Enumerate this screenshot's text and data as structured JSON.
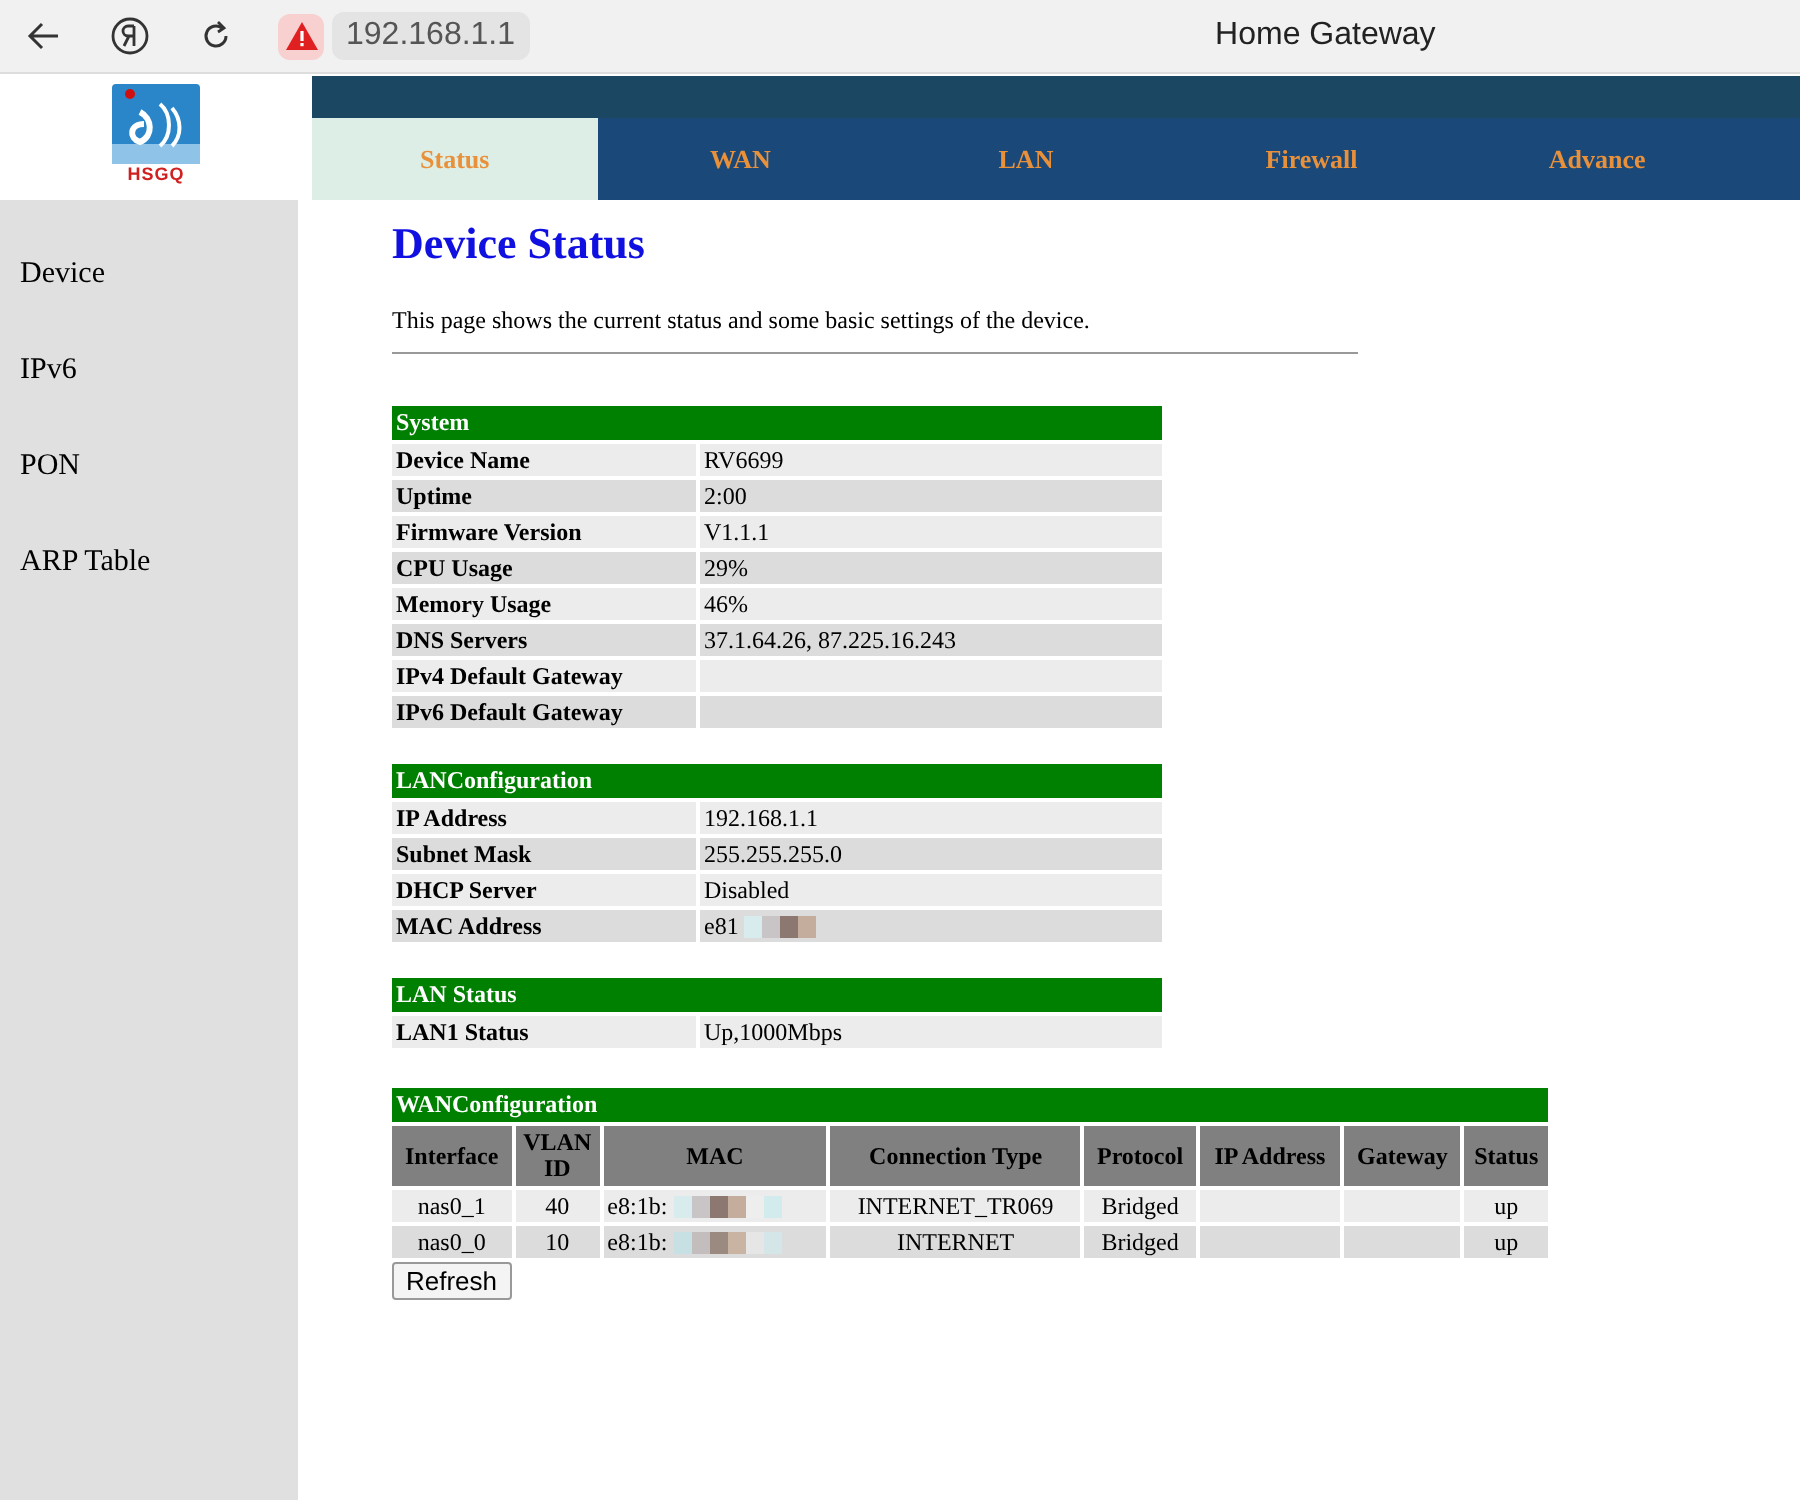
{
  "browser": {
    "address": "192.168.1.1",
    "title": "Home Gateway"
  },
  "logo": {
    "text": "HSGQ"
  },
  "tabs": [
    {
      "label": "Status",
      "selected": true
    },
    {
      "label": "WAN",
      "selected": false
    },
    {
      "label": "LAN",
      "selected": false
    },
    {
      "label": "Firewall",
      "selected": false
    },
    {
      "label": "Advance",
      "selected": false
    }
  ],
  "sidebar": {
    "items": [
      "Device",
      "IPv6",
      "PON",
      "ARP Table"
    ]
  },
  "page": {
    "title": "Device Status",
    "description": "This page shows the current status and some basic settings of the device."
  },
  "sections": [
    {
      "title": "System",
      "rows": [
        {
          "label": "Device Name",
          "value": "RV6699"
        },
        {
          "label": "Uptime",
          "value": "2:00"
        },
        {
          "label": "Firmware Version",
          "value": "V1.1.1"
        },
        {
          "label": "CPU Usage",
          "value": "29%"
        },
        {
          "label": "Memory Usage",
          "value": "46%"
        },
        {
          "label": "DNS Servers",
          "value": "37.1.64.26, 87.225.16.243"
        },
        {
          "label": "IPv4 Default Gateway"
        },
        {
          "label": "IPv6 Default Gateway"
        }
      ]
    },
    {
      "title": "LANConfiguration",
      "rows": [
        {
          "label": "IP Address",
          "value": "192.168.1.1"
        },
        {
          "label": "Subnet Mask",
          "value": "255.255.255.0"
        },
        {
          "label": "DHCP Server",
          "value": "Disabled"
        },
        {
          "label": "MAC Address",
          "value": "e81",
          "redacted": true
        }
      ]
    },
    {
      "title": "LAN Status",
      "rows": [
        {
          "label": "LAN1 Status",
          "value": "Up,1000Mbps"
        }
      ]
    }
  ],
  "wan": {
    "title": "WANConfiguration",
    "columns": [
      "Interface",
      "VLAN ID",
      "MAC",
      "Connection Type",
      "Protocol",
      "IP Address",
      "Gateway",
      "Status"
    ],
    "rows": [
      {
        "interface": "nas0_1",
        "vlan_id": "40",
        "mac": "e8:1b:",
        "mac_redacted": true,
        "connection_type": "INTERNET_TR069",
        "protocol": "Bridged",
        "status": "up"
      },
      {
        "interface": "nas0_0",
        "vlan_id": "10",
        "mac": "e8:1b:",
        "mac_redacted": true,
        "connection_type": "INTERNET",
        "protocol": "Bridged",
        "status": "up"
      }
    ]
  },
  "refresh_button": "Refresh"
}
